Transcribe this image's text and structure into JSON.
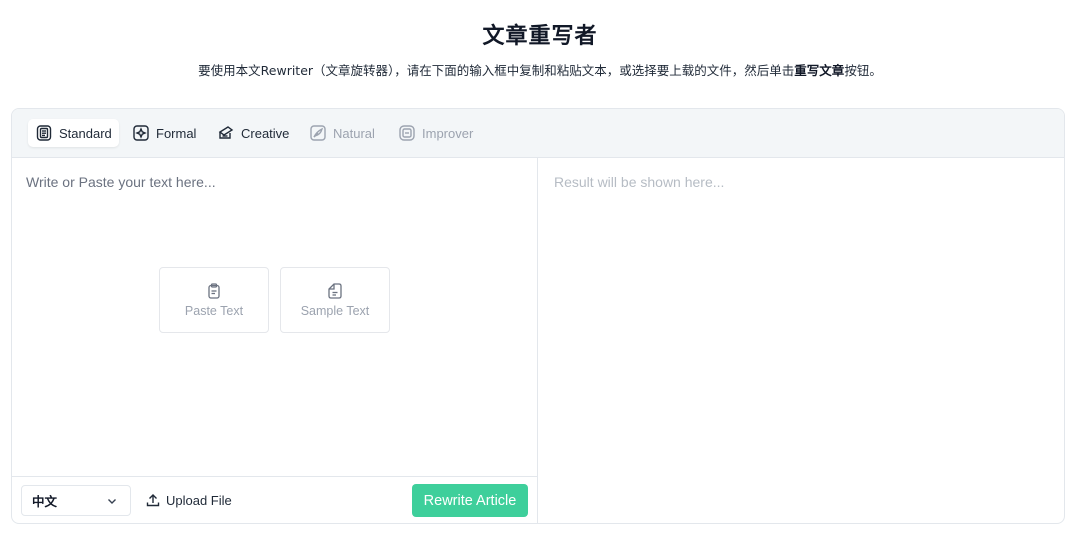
{
  "header": {
    "title": "文章重写者",
    "subtitle_before": "要使用本文Rewriter（文章旋转器），请在下面的输入框中复制和粘贴文本，或选择要上载的文件，然后单击",
    "subtitle_bold": "重写文章",
    "subtitle_after": "按钮。"
  },
  "modes": [
    {
      "label": "Standard",
      "icon": "document-list-icon",
      "state": "active"
    },
    {
      "label": "Formal",
      "icon": "sparkle-box-icon",
      "state": "enabled"
    },
    {
      "label": "Creative",
      "icon": "stack-icon",
      "state": "enabled"
    },
    {
      "label": "Natural",
      "icon": "feather-icon",
      "state": "disabled"
    },
    {
      "label": "Improver",
      "icon": "note-icon",
      "state": "disabled"
    }
  ],
  "editor": {
    "input_placeholder": "Write or Paste your text here...",
    "result_placeholder": "Result will be shown here...",
    "paste_label": "Paste Text",
    "sample_label": "Sample Text"
  },
  "footer": {
    "language": "中文",
    "upload_label": "Upload File",
    "rewrite_label": "Rewrite Article"
  },
  "colors": {
    "accent": "#3ecf9b",
    "border": "#e3e7ec",
    "toolbar_bg": "#f3f6f8",
    "muted_text": "#9ca3af"
  }
}
